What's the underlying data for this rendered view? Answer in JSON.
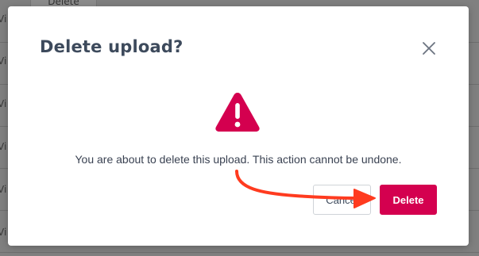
{
  "background": {
    "rows": [
      {
        "link_text": "Vi"
      },
      {
        "link_text": "Vi"
      },
      {
        "link_text": "Vi"
      },
      {
        "link_text": "Vi"
      },
      {
        "link_text": "Vi"
      },
      {
        "link_text": "Vi"
      }
    ],
    "top_button_label": "Delete"
  },
  "modal": {
    "title": "Delete upload?",
    "message": "You are about to delete this upload. This action cannot be undone.",
    "warning_icon": "warning-triangle-icon",
    "close_icon": "close-icon",
    "cancel_label": "Cancel",
    "delete_label": "Delete"
  },
  "colors": {
    "danger": "#d4004f",
    "title": "#3d4a5c",
    "annotation_arrow": "#ff3b1f"
  }
}
